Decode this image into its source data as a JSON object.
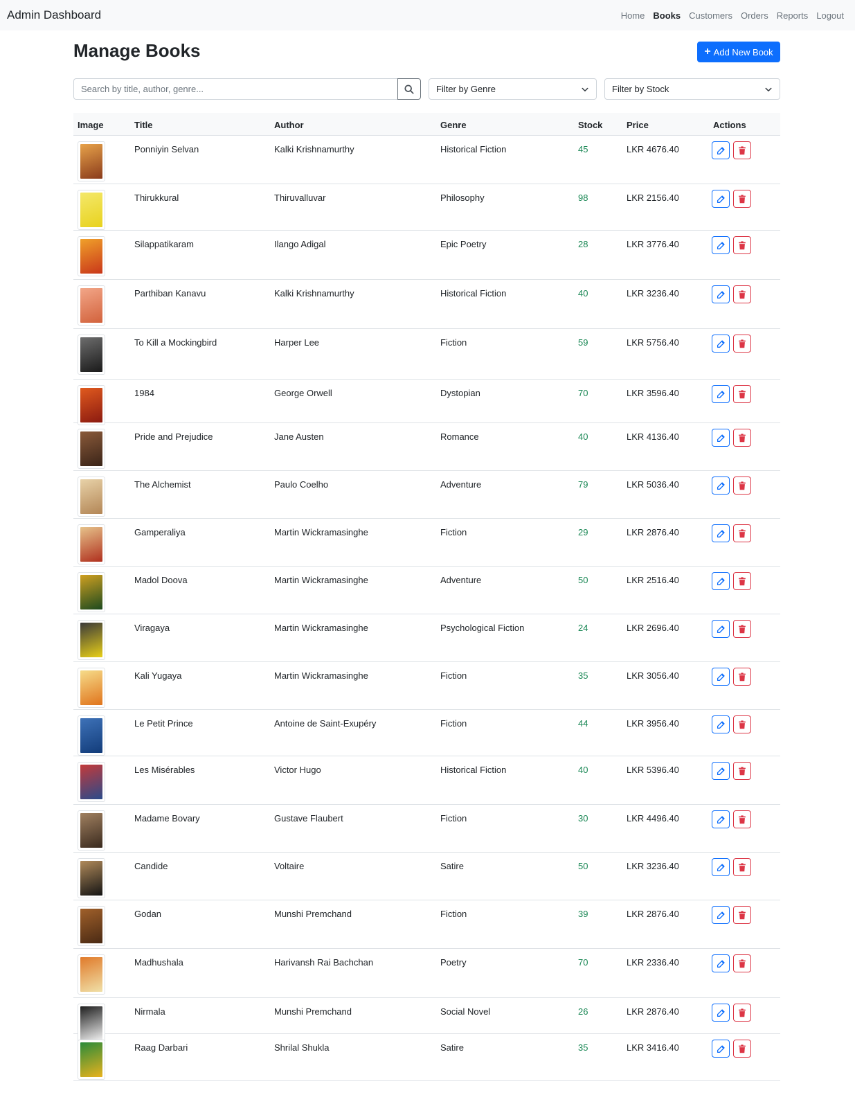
{
  "brand": "Admin Dashboard",
  "nav": [
    {
      "label": "Home",
      "active": false
    },
    {
      "label": "Books",
      "active": true
    },
    {
      "label": "Customers",
      "active": false
    },
    {
      "label": "Orders",
      "active": false
    },
    {
      "label": "Reports",
      "active": false
    },
    {
      "label": "Logout",
      "active": false
    }
  ],
  "page_title": "Manage Books",
  "add_button_label": "Add New Book",
  "search": {
    "placeholder": "Search by title, author, genre..."
  },
  "filters": {
    "genre": "Filter by Genre",
    "stock": "Filter by Stock"
  },
  "columns": [
    "Image",
    "Title",
    "Author",
    "Genre",
    "Stock",
    "Price",
    "Actions"
  ],
  "colors": {
    "primary": "#0d6efd",
    "danger": "#dc3545",
    "success": "#198754",
    "navbar_bg": "#f8f9fa"
  },
  "books": [
    {
      "title": "Ponniyin Selvan",
      "author": "Kalki Krishnamurthy",
      "genre": "Historical Fiction",
      "stock": "45",
      "price": "LKR 4676.40",
      "cover": [
        "#8a3b1b",
        "#e7a24a"
      ]
    },
    {
      "title": "Thirukkural",
      "author": "Thiruvalluvar",
      "genre": "Philosophy",
      "stock": "98",
      "price": "LKR 2156.40",
      "cover": [
        "#e8d21e",
        "#f4e86a"
      ]
    },
    {
      "title": "Silappatikaram",
      "author": "Ilango Adigal",
      "genre": "Epic Poetry",
      "stock": "28",
      "price": "LKR 3776.40",
      "cover": [
        "#c9371a",
        "#f0a02a"
      ]
    },
    {
      "title": "Parthiban Kanavu",
      "author": "Kalki Krishnamurthy",
      "genre": "Historical Fiction",
      "stock": "40",
      "price": "LKR 3236.40",
      "cover": [
        "#d2623c",
        "#f2a688"
      ]
    },
    {
      "title": "To Kill a Mockingbird",
      "author": "Harper Lee",
      "genre": "Fiction",
      "stock": "59",
      "price": "LKR 5756.40",
      "cover": [
        "#1a1a1a",
        "#6d6d6d"
      ]
    },
    {
      "title": "1984",
      "author": "George Orwell",
      "genre": "Dystopian",
      "stock": "70",
      "price": "LKR 3596.40",
      "cover": [
        "#8b1a10",
        "#e05a1e"
      ]
    },
    {
      "title": "Pride and Prejudice",
      "author": "Jane Austen",
      "genre": "Romance",
      "stock": "40",
      "price": "LKR 4136.40",
      "cover": [
        "#3a2418",
        "#8a5a3a"
      ]
    },
    {
      "title": "The Alchemist",
      "author": "Paulo Coelho",
      "genre": "Adventure",
      "stock": "79",
      "price": "LKR 5036.40",
      "cover": [
        "#b38656",
        "#e8d2a8"
      ]
    },
    {
      "title": "Gamperaliya",
      "author": "Martin Wickramasinghe",
      "genre": "Fiction",
      "stock": "29",
      "price": "LKR 2876.40",
      "cover": [
        "#b0301e",
        "#e6c28a"
      ]
    },
    {
      "title": "Madol Doova",
      "author": "Martin Wickramasinghe",
      "genre": "Adventure",
      "stock": "50",
      "price": "LKR 2516.40",
      "cover": [
        "#1d4a1f",
        "#d0a020"
      ]
    },
    {
      "title": "Viragaya",
      "author": "Martin Wickramasinghe",
      "genre": "Psychological Fiction",
      "stock": "24",
      "price": "LKR 2696.40",
      "cover": [
        "#e8cf18",
        "#3a3a3a"
      ]
    },
    {
      "title": "Kali Yugaya",
      "author": "Martin Wickramasinghe",
      "genre": "Fiction",
      "stock": "35",
      "price": "LKR 3056.40",
      "cover": [
        "#e0741c",
        "#f6dc8a"
      ]
    },
    {
      "title": "Le Petit Prince",
      "author": "Antoine de Saint-Exupéry",
      "genre": "Fiction",
      "stock": "44",
      "price": "LKR 3956.40",
      "cover": [
        "#123c7a",
        "#3e72b8"
      ]
    },
    {
      "title": "Les Misérables",
      "author": "Victor Hugo",
      "genre": "Historical Fiction",
      "stock": "40",
      "price": "LKR 5396.40",
      "cover": [
        "#2a4a8a",
        "#c43a3a"
      ]
    },
    {
      "title": "Madame Bovary",
      "author": "Gustave Flaubert",
      "genre": "Fiction",
      "stock": "30",
      "price": "LKR 4496.40",
      "cover": [
        "#3a2a1e",
        "#a08060"
      ]
    },
    {
      "title": "Candide",
      "author": "Voltaire",
      "genre": "Satire",
      "stock": "50",
      "price": "LKR 3236.40",
      "cover": [
        "#141414",
        "#b08a5a"
      ]
    },
    {
      "title": "Godan",
      "author": "Munshi Premchand",
      "genre": "Fiction",
      "stock": "39",
      "price": "LKR 2876.40",
      "cover": [
        "#4a2a14",
        "#a0602a"
      ]
    },
    {
      "title": "Madhushala",
      "author": "Harivansh Rai Bachchan",
      "genre": "Poetry",
      "stock": "70",
      "price": "LKR 2336.40",
      "cover": [
        "#f0e0a8",
        "#e07a2a"
      ]
    },
    {
      "title": "Nirmala",
      "author": "Munshi Premchand",
      "genre": "Social Novel",
      "stock": "26",
      "price": "LKR 2876.40",
      "cover": [
        "#f4f4f4",
        "#1e1e1e"
      ]
    },
    {
      "title": "Raag Darbari",
      "author": "Shrilal Shukla",
      "genre": "Satire",
      "stock": "35",
      "price": "LKR 3416.40",
      "cover": [
        "#e8b21e",
        "#2a8a3a"
      ]
    }
  ]
}
